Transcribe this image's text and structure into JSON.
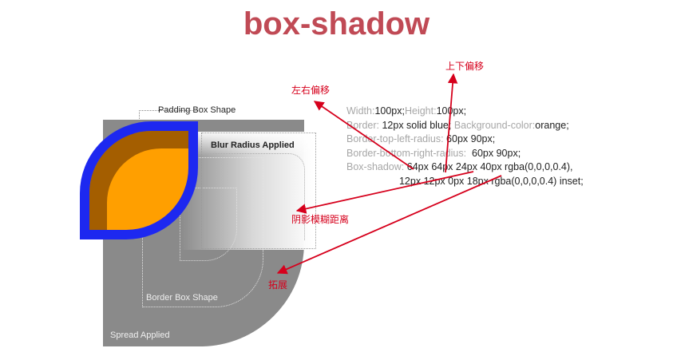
{
  "title": "box-shadow",
  "corner_text": {
    "prefix": "...",
    "suffix": "■"
  },
  "labels": {
    "padding_box": "Padding Box Shape",
    "blur_radius": "Blur Radius Applied",
    "border_box": "Border Box Shape",
    "spread": "Spread Applied"
  },
  "code": [
    {
      "key": "Width:",
      "val": "100px;",
      "key2": "Height:",
      "val2": "100px;"
    },
    {
      "key": "Border:",
      "val": " 12px solid blue;",
      "key2": " Background-color:",
      "val2": "orange;"
    },
    {
      "key": "Border-top-left-radius:",
      "val": " 60px 90px;"
    },
    {
      "key": "Border-bottom-right-radius:",
      "val": "  60px 90px;"
    },
    {
      "key": "Box-shadow:",
      "val": " 64px 64px 24px 40px rgba(0,0,0,0.4),"
    },
    {
      "key": "",
      "val": "                   12px 12px 0px 18px rgba(0,0,0,0.4) inset;"
    }
  ],
  "annotations": {
    "left_right_offset": "左右偏移",
    "up_down_offset": "上下偏移",
    "blur_distance": "阴影模糊距离",
    "spread": "拓展"
  },
  "colors": {
    "title": "#c04a55",
    "border": "#1d28f0",
    "background": "#ff9f00",
    "shadow": "#8a8a8a",
    "arrow": "#d6001c"
  }
}
